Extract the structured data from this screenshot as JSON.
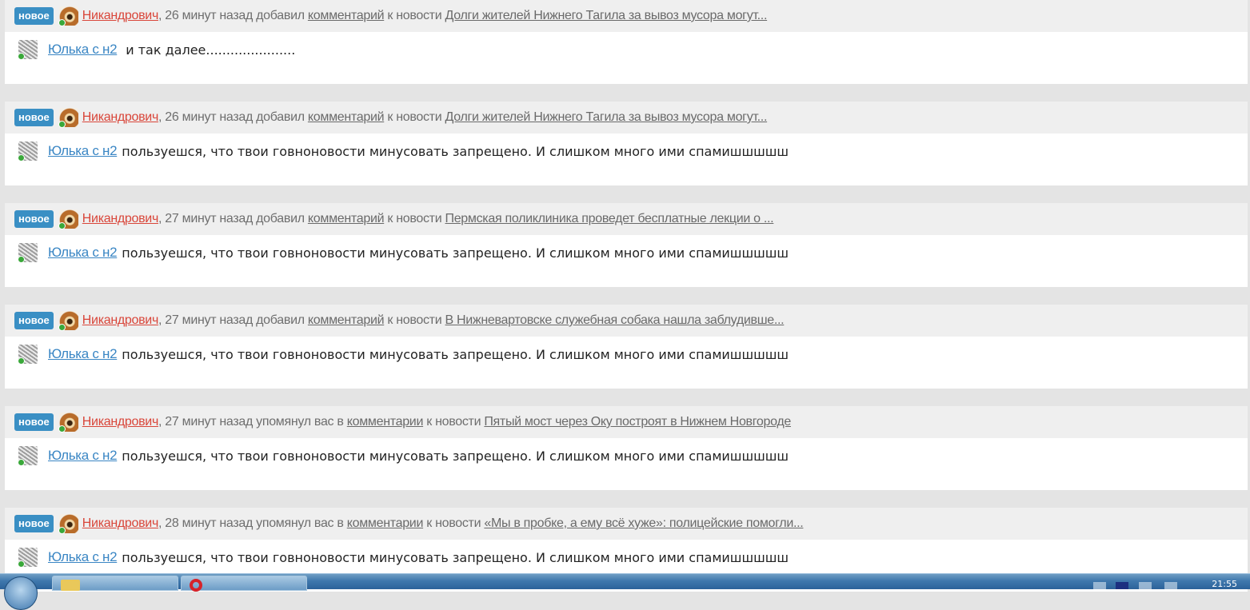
{
  "colors": {
    "badge": "#3a8fc4",
    "author": "#d9463a",
    "commenter": "#3a86c4",
    "header_bg": "#efefef",
    "body_bg": "#ffffff"
  },
  "notifications": [
    {
      "badge": "новое",
      "author": "Никандрович",
      "time": ", 26 минут назад добавил ",
      "action_link": "комментарий",
      "to_news": " к новости ",
      "news_title": "Долги жителей Нижнего Тагила за вывоз мусора могут...",
      "commenter": "Юлька с н2",
      "comment": "и так далее......................"
    },
    {
      "badge": "новое",
      "author": "Никандрович",
      "time": ", 26 минут назад добавил ",
      "action_link": "комментарий",
      "to_news": " к новости ",
      "news_title": "Долги жителей Нижнего Тагила за вывоз мусора могут...",
      "commenter": "Юлька с н2",
      "comment": "пользуешся, что твои говноновости минусовать запрещено. И слишком много ими спамишшшшш"
    },
    {
      "badge": "новое",
      "author": "Никандрович",
      "time": ", 27 минут назад добавил ",
      "action_link": "комментарий",
      "to_news": " к новости ",
      "news_title": "Пермская поликлиника проведет бесплатные лекции о ...",
      "commenter": "Юлька с н2",
      "comment": "пользуешся, что твои говноновости минусовать запрещено. И слишком много ими спамишшшшш"
    },
    {
      "badge": "новое",
      "author": "Никандрович",
      "time": ", 27 минут назад добавил ",
      "action_link": "комментарий",
      "to_news": " к новости ",
      "news_title": "В Нижневартовске служебная собака нашла заблудивше...",
      "commenter": "Юлька с н2",
      "comment": "пользуешся, что твои говноновости минусовать запрещено. И слишком много ими спамишшшшш"
    },
    {
      "badge": "новое",
      "author": "Никандрович",
      "time": ", 27 минут назад упомянул вас в ",
      "action_link": "комментарии",
      "to_news": " к новости ",
      "news_title": "Пятый мост через Оку построят в Нижнем Новгороде",
      "commenter": "Юлька с н2",
      "comment": "пользуешся, что твои говноновости минусовать запрещено. И слишком много ими спамишшшшш"
    },
    {
      "badge": "новое",
      "author": "Никандрович",
      "time": ", 28 минут назад упомянул вас в ",
      "action_link": "комментарии",
      "to_news": " к новости ",
      "news_title": "«Мы в пробке, а ему всё хуже»: полицейские помогли...",
      "commenter": "Юлька с н2",
      "comment": "пользуешся, что твои говноновости минусовать запрещено. И слишком много ими спамишшшшш"
    }
  ],
  "taskbar": {
    "clock": "21:55",
    "icons": [
      "start-orb-icon",
      "folder-icon",
      "opera-icon",
      "tray-icon"
    ]
  }
}
